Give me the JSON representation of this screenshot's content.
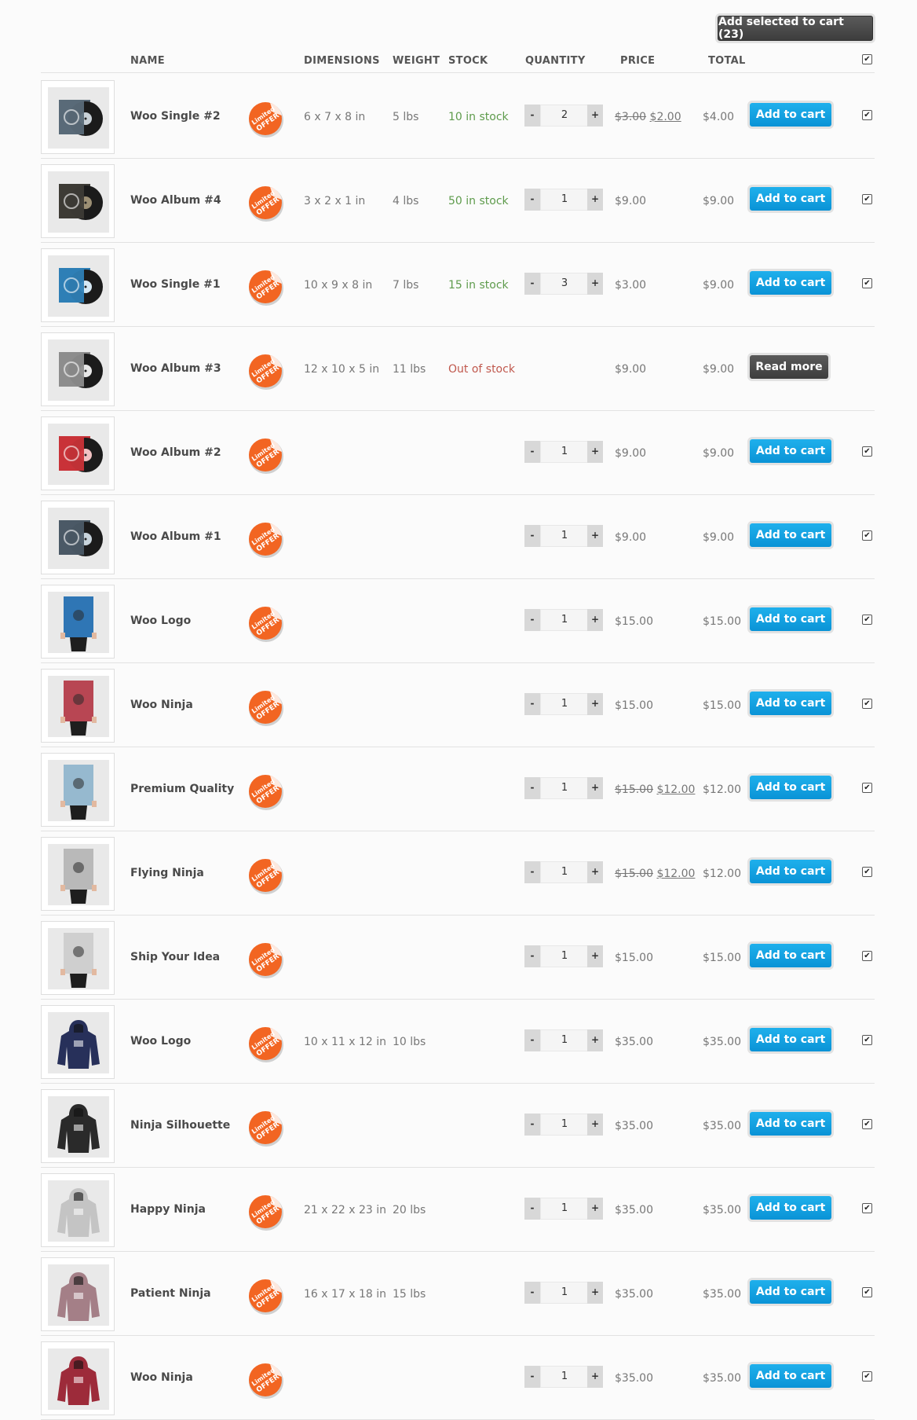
{
  "top_button": "Add selected to cart (23)",
  "headers": {
    "name": "NAME",
    "dimensions": "DIMENSIONS",
    "weight": "WEIGHT",
    "stock": "STOCK",
    "quantity": "QUANTITY",
    "price": "PRICE",
    "total": "TOTAL"
  },
  "badge_text": "Limited OFFER",
  "colors": {
    "accent_blue": "#0a93d6",
    "dark_button": "#3d3d3d",
    "badge_orange": "#f26522",
    "in_stock": "#5e9b4c",
    "out_of_stock": "#c0584d"
  },
  "rows": [
    {
      "name": "Woo Single #2",
      "thumb": "vinyl-gray",
      "dimensions": "6 x 7 x 8 in",
      "weight": "5 lbs",
      "stock": "10 in stock",
      "stock_status": "in",
      "qty": "2",
      "price_old": "$3.00",
      "price": "$2.00",
      "total": "$4.00",
      "action": "Add to cart",
      "checked": true
    },
    {
      "name": "Woo Album #4",
      "thumb": "vinyl-dark",
      "dimensions": "3 x 2 x 1 in",
      "weight": "4 lbs",
      "stock": "50 in stock",
      "stock_status": "in",
      "qty": "1",
      "price_old": "",
      "price": "$9.00",
      "total": "$9.00",
      "action": "Add to cart",
      "checked": true
    },
    {
      "name": "Woo Single #1",
      "thumb": "vinyl-blue",
      "dimensions": "10 x 9 x 8 in",
      "weight": "7 lbs",
      "stock": "15 in stock",
      "stock_status": "in",
      "qty": "3",
      "price_old": "",
      "price": "$3.00",
      "total": "$9.00",
      "action": "Add to cart",
      "checked": true
    },
    {
      "name": "Woo Album #3",
      "thumb": "vinyl-light",
      "dimensions": "12 x 10 x 5 in",
      "weight": "11 lbs",
      "stock": "Out of stock",
      "stock_status": "out",
      "qty": "",
      "price_old": "",
      "price": "$9.00",
      "total": "$9.00",
      "action": "Read more",
      "checked": false
    },
    {
      "name": "Woo Album #2",
      "thumb": "vinyl-red",
      "dimensions": "",
      "weight": "",
      "stock": "",
      "stock_status": "",
      "qty": "1",
      "price_old": "",
      "price": "$9.00",
      "total": "$9.00",
      "action": "Add to cart",
      "checked": true
    },
    {
      "name": "Woo Album #1",
      "thumb": "vinyl-slate",
      "dimensions": "",
      "weight": "",
      "stock": "",
      "stock_status": "",
      "qty": "1",
      "price_old": "",
      "price": "$9.00",
      "total": "$9.00",
      "action": "Add to cart",
      "checked": true
    },
    {
      "name": "Woo Logo",
      "thumb": "poster-blue",
      "dimensions": "",
      "weight": "",
      "stock": "",
      "stock_status": "",
      "qty": "1",
      "price_old": "",
      "price": "$15.00",
      "total": "$15.00",
      "action": "Add to cart",
      "checked": true
    },
    {
      "name": "Woo Ninja",
      "thumb": "poster-red",
      "dimensions": "",
      "weight": "",
      "stock": "",
      "stock_status": "",
      "qty": "1",
      "price_old": "",
      "price": "$15.00",
      "total": "$15.00",
      "action": "Add to cart",
      "checked": true
    },
    {
      "name": "Premium Quality",
      "thumb": "poster-lightblue",
      "dimensions": "",
      "weight": "",
      "stock": "",
      "stock_status": "",
      "qty": "1",
      "price_old": "$15.00",
      "price": "$12.00",
      "total": "$12.00",
      "action": "Add to cart",
      "checked": true
    },
    {
      "name": "Flying Ninja",
      "thumb": "poster-gray",
      "dimensions": "",
      "weight": "",
      "stock": "",
      "stock_status": "",
      "qty": "1",
      "price_old": "$15.00",
      "price": "$12.00",
      "total": "$12.00",
      "action": "Add to cart",
      "checked": true
    },
    {
      "name": "Ship Your Idea",
      "thumb": "poster-skull",
      "dimensions": "",
      "weight": "",
      "stock": "",
      "stock_status": "",
      "qty": "1",
      "price_old": "",
      "price": "$15.00",
      "total": "$15.00",
      "action": "Add to cart",
      "checked": true
    },
    {
      "name": "Woo Logo",
      "thumb": "hoodie-navy",
      "dimensions": "10 x 11 x 12 in",
      "weight": "10 lbs",
      "stock": "",
      "stock_status": "",
      "qty": "1",
      "price_old": "",
      "price": "$35.00",
      "total": "$35.00",
      "action": "Add to cart",
      "checked": true
    },
    {
      "name": "Ninja Silhouette",
      "thumb": "hoodie-black",
      "dimensions": "",
      "weight": "",
      "stock": "",
      "stock_status": "",
      "qty": "1",
      "price_old": "",
      "price": "$35.00",
      "total": "$35.00",
      "action": "Add to cart",
      "checked": true
    },
    {
      "name": "Happy Ninja",
      "thumb": "hoodie-gray",
      "dimensions": "21 x 22 x 23 in",
      "weight": "20 lbs",
      "stock": "",
      "stock_status": "",
      "qty": "1",
      "price_old": "",
      "price": "$35.00",
      "total": "$35.00",
      "action": "Add to cart",
      "checked": true
    },
    {
      "name": "Patient Ninja",
      "thumb": "hoodie-pink",
      "dimensions": "16 x 17 x 18 in",
      "weight": "15 lbs",
      "stock": "",
      "stock_status": "",
      "qty": "1",
      "price_old": "",
      "price": "$35.00",
      "total": "$35.00",
      "action": "Add to cart",
      "checked": true
    },
    {
      "name": "Woo Ninja",
      "thumb": "hoodie-red",
      "dimensions": "",
      "weight": "",
      "stock": "",
      "stock_status": "",
      "qty": "1",
      "price_old": "",
      "price": "$35.00",
      "total": "$35.00",
      "action": "Add to cart",
      "checked": true
    }
  ]
}
